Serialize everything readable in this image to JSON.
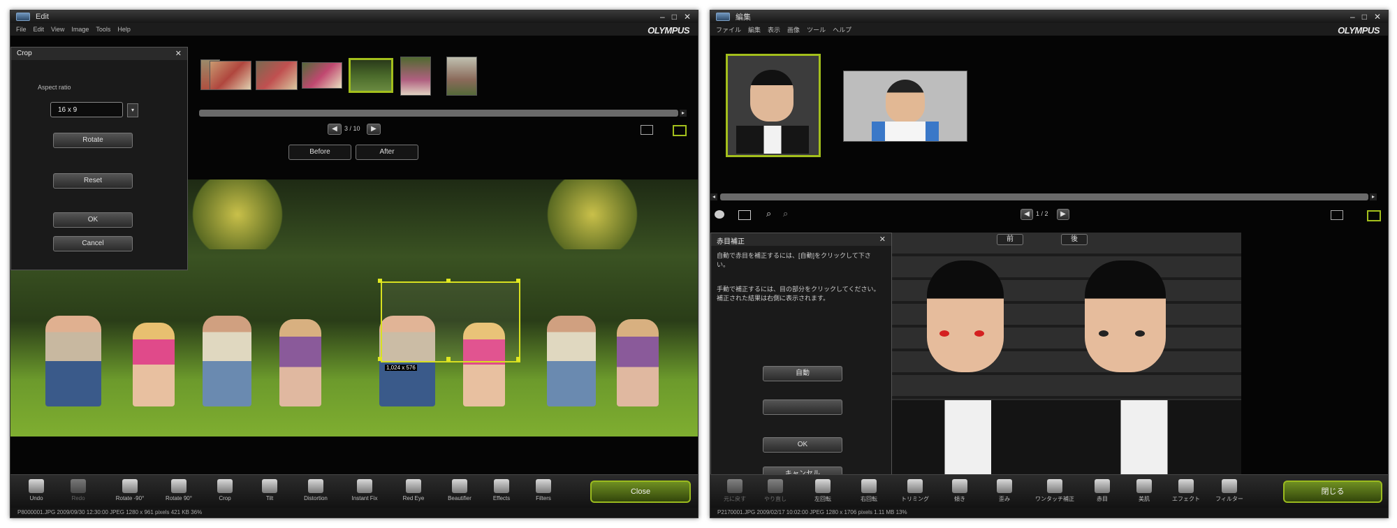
{
  "left": {
    "title": "Edit",
    "menu": [
      "File",
      "Edit",
      "View",
      "Image",
      "Tools",
      "Help"
    ],
    "brand": "OLYMPUS",
    "crop_panel": {
      "title": "Crop",
      "aspect_label": "Aspect ratio",
      "aspect_value": "16 x 9",
      "rotate": "Rotate",
      "reset": "Reset",
      "ok": "OK",
      "cancel": "Cancel"
    },
    "counter": "3 / 10",
    "compare_tabs": [
      "Before",
      "After"
    ],
    "crop_label": "1,024 x 576",
    "tools": [
      "Undo",
      "Redo",
      "Rotate -90°",
      "Rotate 90°",
      "Crop",
      "Tilt",
      "Distortion",
      "Instant Fix",
      "Red Eye",
      "Beautifier",
      "Effects",
      "Filters"
    ],
    "close": "Close",
    "status": "P8000001.JPG   2009/09/30 12:30:00   JPEG   1280 x 961 pixels   421 KB   36%",
    "colors": {
      "accent": "#a3bf1c",
      "background": "#050505"
    }
  },
  "right": {
    "title": "編集",
    "menu": [
      "ファイル",
      "編集",
      "表示",
      "画像",
      "ツール",
      "ヘルプ"
    ],
    "brand": "OLYMPUS",
    "counter": "1 / 2",
    "compare_tabs": [
      "前",
      "後"
    ],
    "redeye_panel": {
      "title": "赤目補正",
      "text1": "自動で赤目を補正するには、[自動]をクリックして下さい。",
      "text2": "手動で補正するには、目の部分をクリックしてください。補正された結果は右側に表示されます。",
      "auto": "自動",
      "manual": "",
      "ok": "OK",
      "cancel": "キャンセル"
    },
    "tools": [
      "元に戻す",
      "やり直し",
      "左回転",
      "右回転",
      "トリミング",
      "傾き",
      "歪み",
      "ワンタッチ補正",
      "赤目",
      "美肌",
      "エフェクト",
      "フィルター"
    ],
    "close": "閉じる",
    "status": "P2170001.JPG   2009/02/17 10:02:00   JPEG   1280 x 1706 pixels   1.11 MB   13%"
  }
}
